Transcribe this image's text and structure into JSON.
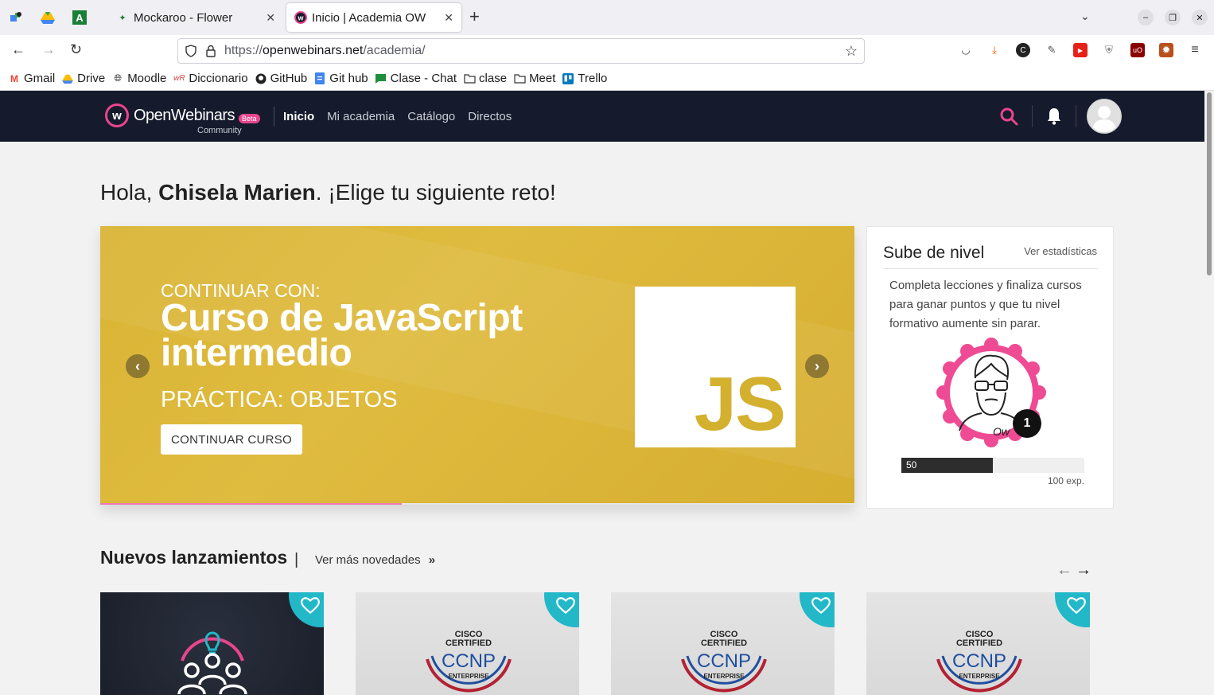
{
  "browser": {
    "tabs": [
      {
        "title": "Mockaroo - Flower",
        "active": false
      },
      {
        "title": "Inicio | Academia OW",
        "active": true
      }
    ],
    "url": {
      "protocol": "https://",
      "host": "openwebinars.net",
      "path": "/academia/"
    },
    "bookmarks": [
      {
        "label": "Gmail",
        "icon": "gmail-icon"
      },
      {
        "label": "Drive",
        "icon": "drive-icon"
      },
      {
        "label": "Moodle",
        "icon": "globe-icon"
      },
      {
        "label": "Diccionario",
        "icon": "wordreference-icon"
      },
      {
        "label": "GitHub",
        "icon": "github-icon"
      },
      {
        "label": "Git hub",
        "icon": "docs-icon"
      },
      {
        "label": "Clase - Chat",
        "icon": "chat-icon"
      },
      {
        "label": "clase",
        "icon": "folder-icon"
      },
      {
        "label": "Meet",
        "icon": "folder-icon"
      },
      {
        "label": "Trello",
        "icon": "trello-icon"
      }
    ]
  },
  "site": {
    "logo_text": "OpenWebinars",
    "logo_beta": "Beta",
    "logo_community": "Community",
    "nav": [
      "Inicio",
      "Mi academia",
      "Catálogo",
      "Directos"
    ]
  },
  "greeting": {
    "prefix": "Hola, ",
    "name": "Chisela Marien",
    "suffix": ". ¡Elige tu siguiente reto!"
  },
  "hero": {
    "kicker": "CONTINUAR CON:",
    "title": "Curso de JavaScript intermedio",
    "subtitle": "PRÁCTICA: OBJETOS",
    "button": "CONTINUAR CURSO",
    "logo_text": "JS",
    "slide_progress": 0.4,
    "bg_color": "#dbb63a"
  },
  "level": {
    "title": "Sube de nivel",
    "link": "Ver estadísticas",
    "description": "Completa lecciones y finaliza cursos para ganar puntos y que tu nivel formativo aumente sin parar.",
    "level_number": "1",
    "xp_current": "50",
    "xp_max": "100 exp.",
    "xp_fraction": 0.5
  },
  "releases": {
    "title": "Nuevos lanzamientos",
    "separator": "|",
    "link": "Ver más novedades",
    "cards": [
      {
        "type": "dark",
        "icon": "team-idea-icon"
      },
      {
        "type": "cisco",
        "cisco_top": "CISCO",
        "cisco_mid": "CERTIFIED",
        "cisco_name": "CCNP",
        "cisco_sub": "ENTERPRISE"
      },
      {
        "type": "cisco",
        "cisco_top": "CISCO",
        "cisco_mid": "CERTIFIED",
        "cisco_name": "CCNP",
        "cisco_sub": "ENTERPRISE"
      },
      {
        "type": "cisco",
        "cisco_top": "CISCO",
        "cisco_mid": "CERTIFIED",
        "cisco_name": "CCNP",
        "cisco_sub": "ENTERPRISE"
      }
    ]
  },
  "colors": {
    "accent_pink": "#e9458d",
    "header_bg": "#151b2c",
    "fav_teal": "#22b8c8"
  }
}
